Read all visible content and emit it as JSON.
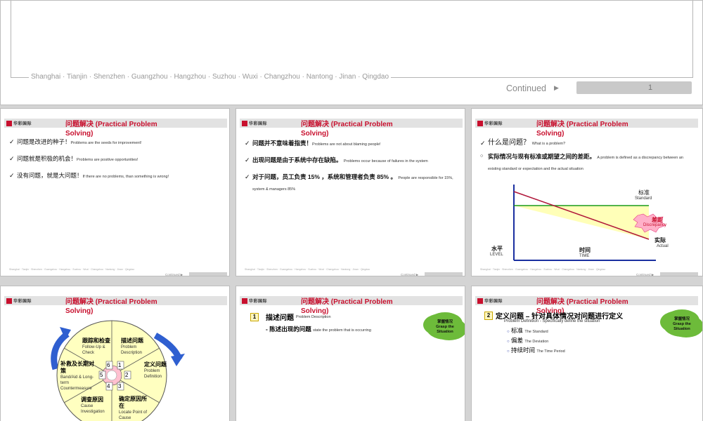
{
  "top_slide": {
    "cities": "Shanghai · Tianjin · Shenzhen · Guangzhou · Hangzhou · Suzhou · Wuxi · Changzhou · Nantong · Jinan · Qingdao",
    "continued": "Continued",
    "page": "1"
  },
  "common": {
    "title_line1": "问题解决 (Practical Problem",
    "title_line2": "Solving)",
    "logo_text": "华彩国际",
    "footer_cities": "Shanghai · Tianjin · Shenzhen · Guangzhou · Hangzhou · Suzhou · Wuxi · Changzhou · Nantong · Jinan · Qingdao",
    "continued": "Continued"
  },
  "slide1": {
    "bullets": [
      {
        "zh": "问题是改进的种子！",
        "en": "Problems are the seeds for improvement!"
      },
      {
        "zh": "问题就是积极的机会！",
        "en": "Problems are positive opportunities!"
      },
      {
        "zh": "没有问题，就是大问题！",
        "en": "If there are no problems, than something is wrong!"
      }
    ]
  },
  "slide2": {
    "bullets": [
      {
        "zh": "问题并不意味着指责！",
        "en": "Problems are not about blaming people!"
      },
      {
        "zh": "出现问题是由于系统中存在缺陷。",
        "en": "Problems occur because of failures in the system"
      },
      {
        "zh": "对于问题，员工负责 15% ，系统和管理者负责 85% 。",
        "en": "People are responsible for 15%, system & managers 85%"
      }
    ]
  },
  "slide3": {
    "q_zh": "什么是问题？",
    "q_en": "What is a problem?",
    "def_zh": "实际情况与现有标准或期望之间的差距。",
    "def_en": "A problem is defined as a discrepancy between an existing standard or expectation and the actual situation",
    "standard_zh": "标准",
    "standard_en": "Standard",
    "gap_zh": "差距",
    "gap_en": "Discrepancy",
    "actual_zh": "实际",
    "actual_en": "Actual",
    "level_zh": "水平",
    "level_en": "LEVEL",
    "time_zh": "时间",
    "time_en": "TIME"
  },
  "slide4": {
    "segments": [
      {
        "n": "1",
        "zh": "描述问题",
        "en": "Problem Description"
      },
      {
        "n": "2",
        "zh": "定义问题",
        "en": "Problem Definition"
      },
      {
        "n": "3",
        "zh": "确定原因所在",
        "en": "Locate Point of Cause"
      },
      {
        "n": "4",
        "zh": "调查原因",
        "en": "Cause Investigation"
      },
      {
        "n": "5",
        "zh": "补救及长期对策",
        "en": "Band/Aid & Long-term Countermeasure"
      },
      {
        "n": "6",
        "zh": "跟踪和检查",
        "en": "Follow-Up & Check"
      }
    ]
  },
  "slide5": {
    "num": "1",
    "heading_zh": "描述问题",
    "heading_en": "Problem Description",
    "sub_zh": "- 陈述出现的问题",
    "sub_en": "state the problem that is occurring",
    "cloud_zh": "掌握情况",
    "cloud_en1": "Grasp the",
    "cloud_en2": "Situation"
  },
  "slide6": {
    "num": "2",
    "heading_zh": "定义问题 – 针对具体情况对问题进行定义",
    "sub_en": "Problem Definition - Specifically define the situation",
    "items": [
      {
        "zh": "标准",
        "en": "The Standard"
      },
      {
        "zh": "偏差",
        "en": "The Deviation"
      },
      {
        "zh": "持续时间",
        "en": "The Time Period"
      }
    ],
    "cloud_zh": "掌握情况",
    "cloud_en1": "Grasp the",
    "cloud_en2": "Situation"
  }
}
